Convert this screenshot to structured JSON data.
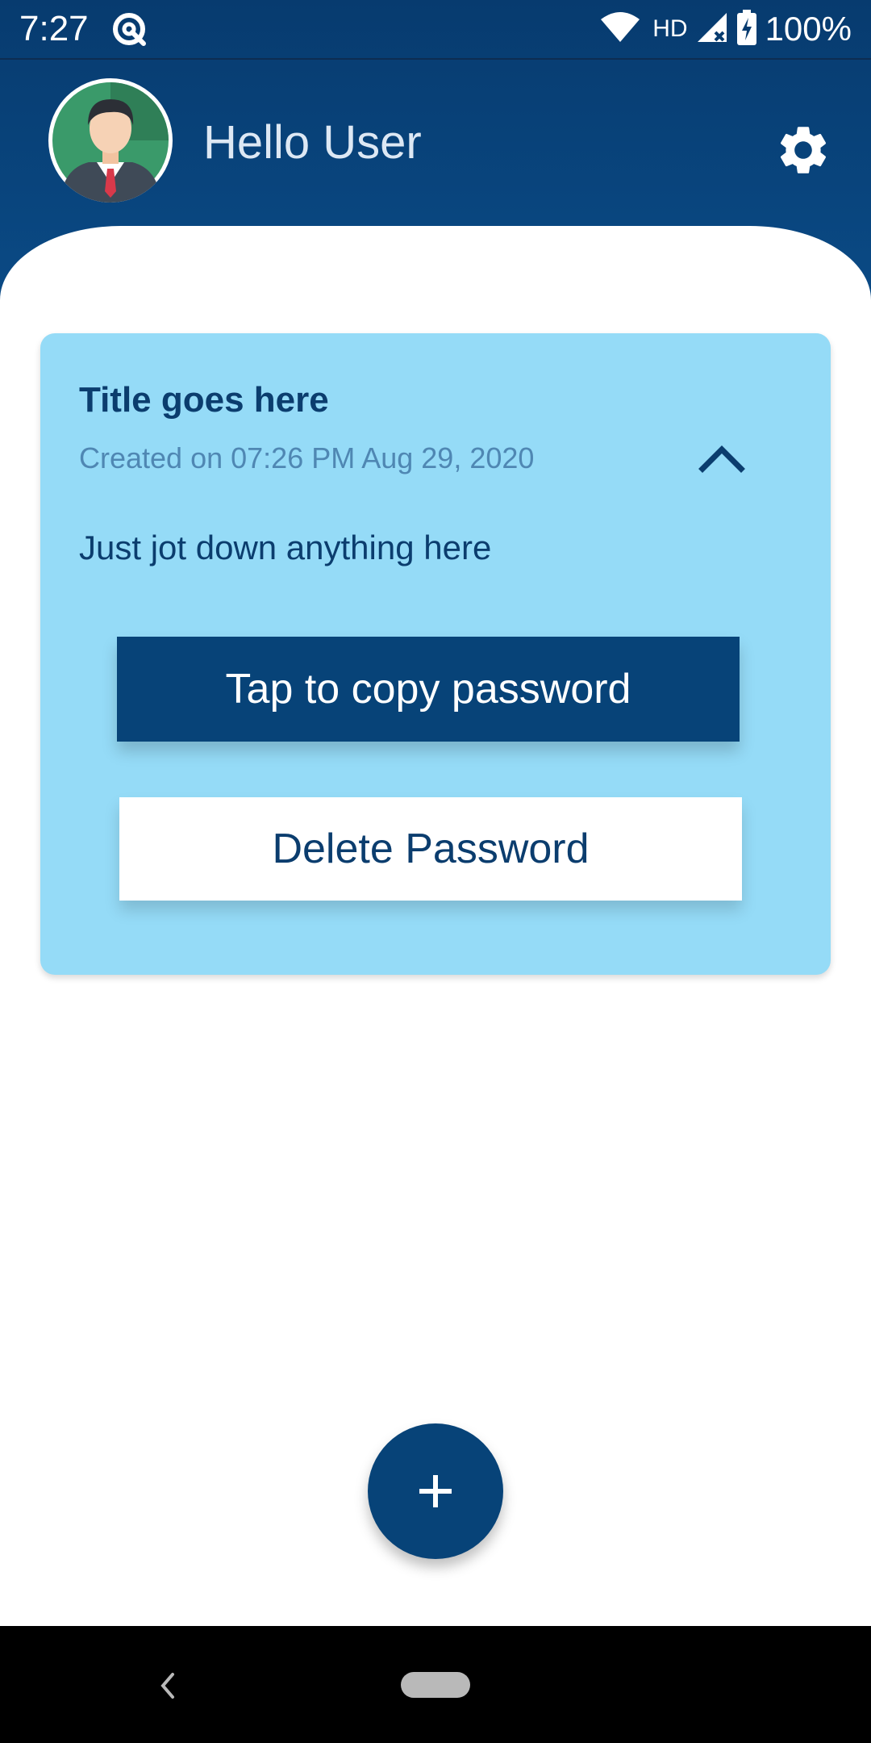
{
  "status_bar": {
    "time": "7:27",
    "network_label": "HD",
    "battery": "100%",
    "icons": [
      "app-at-icon",
      "wifi-icon",
      "signal-icon",
      "battery-charging-icon"
    ]
  },
  "header": {
    "greeting": "Hello User",
    "avatar_icon": "user-avatar",
    "settings_icon": "gear-icon"
  },
  "card": {
    "title": "Title goes here",
    "created": "Created on 07:26 PM Aug 29, 2020",
    "body": "Just jot down anything here",
    "copy_label": "Tap to copy password",
    "delete_label": "Delete Password",
    "collapse_icon": "chevron-up-icon"
  },
  "fab": {
    "icon": "plus-icon"
  },
  "nav": {
    "back_icon": "back-chevron-icon",
    "home_icon": "home-pill-icon"
  },
  "colors": {
    "primary": "#074378",
    "card_background": "#95dbf7",
    "header_gradient_top": "#073b6f",
    "header_gradient_bottom": "#0a4a85"
  }
}
